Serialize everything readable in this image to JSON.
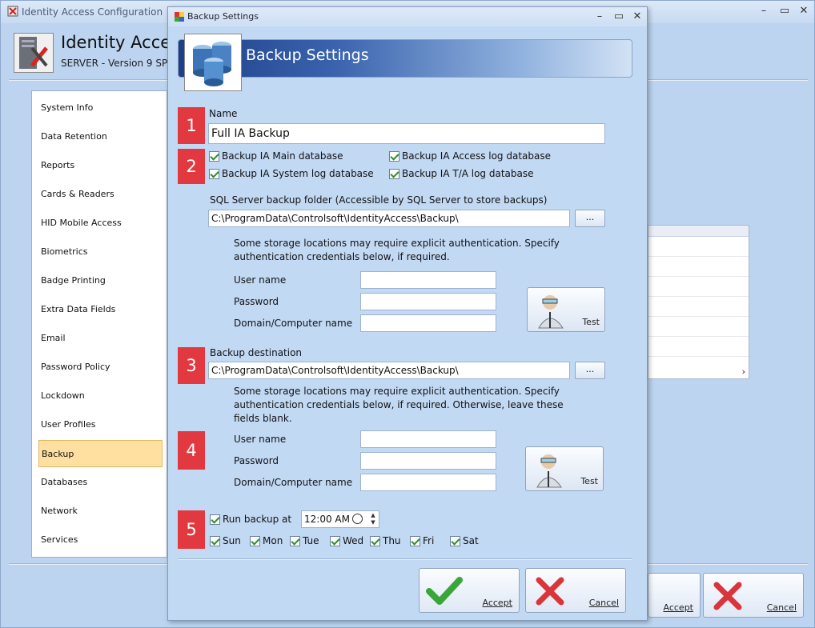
{
  "app": {
    "window_title": "Identity Access Configuration",
    "header_title": "Identity Access",
    "header_subtitle": "SERVER - Version 9 SP"
  },
  "sidebar": {
    "items": [
      {
        "label": "System Info"
      },
      {
        "label": "Data Retention"
      },
      {
        "label": "Reports"
      },
      {
        "label": "Cards & Readers"
      },
      {
        "label": "HID Mobile Access"
      },
      {
        "label": "Biometrics"
      },
      {
        "label": "Badge Printing"
      },
      {
        "label": "Extra Data Fields"
      },
      {
        "label": "Email"
      },
      {
        "label": "Password Policy"
      },
      {
        "label": "Lockdown"
      },
      {
        "label": "User Profiles"
      },
      {
        "label": "Backup"
      },
      {
        "label": "Databases"
      },
      {
        "label": "Network"
      },
      {
        "label": "Services"
      }
    ],
    "active": "Backup"
  },
  "main_buttons": {
    "accept": "Accept",
    "cancel": "Cancel"
  },
  "dialog": {
    "title": "Backup Settings",
    "banner_title": "Backup Settings",
    "steps": [
      "1",
      "2",
      "3",
      "4",
      "5"
    ],
    "name_label": "Name",
    "name_value": "Full IA Backup",
    "checkboxes": {
      "main_db": "Backup IA Main database",
      "access_log_db": "Backup IA Access log database",
      "system_log_db": "Backup IA System log database",
      "ta_log_db": "Backup IA T/A log database"
    },
    "sql_folder_label": "SQL Server backup folder (Accessible by SQL Server to store backups)",
    "sql_folder_value": "C:\\ProgramData\\Controlsoft\\IdentityAccess\\Backup\\",
    "browse_label": "...",
    "auth_note_1": "Some storage locations may require explicit authentication. Specify authentication credentials below, if required.",
    "user_name_label": "User name",
    "password_label": "Password",
    "domain_label": "Domain/Computer name",
    "test_label": "Test",
    "destination_label": "Backup destination",
    "destination_value": "C:\\ProgramData\\Controlsoft\\IdentityAccess\\Backup\\",
    "auth_note_2": "Some storage locations may require explicit authentication. Specify authentication credentials below, if required. Otherwise, leave these fields blank.",
    "run_backup_label": "Run backup at",
    "time_value": "12:00 AM",
    "days": [
      "Sun",
      "Mon",
      "Tue",
      "Wed",
      "Thu",
      "Fri",
      "Sat"
    ],
    "accept_label": "Accept",
    "cancel_label": "Cancel"
  },
  "colors": {
    "step_badge": "#e2383f",
    "active_item": "#ffe0a0",
    "banner_start": "#1c3f87"
  }
}
